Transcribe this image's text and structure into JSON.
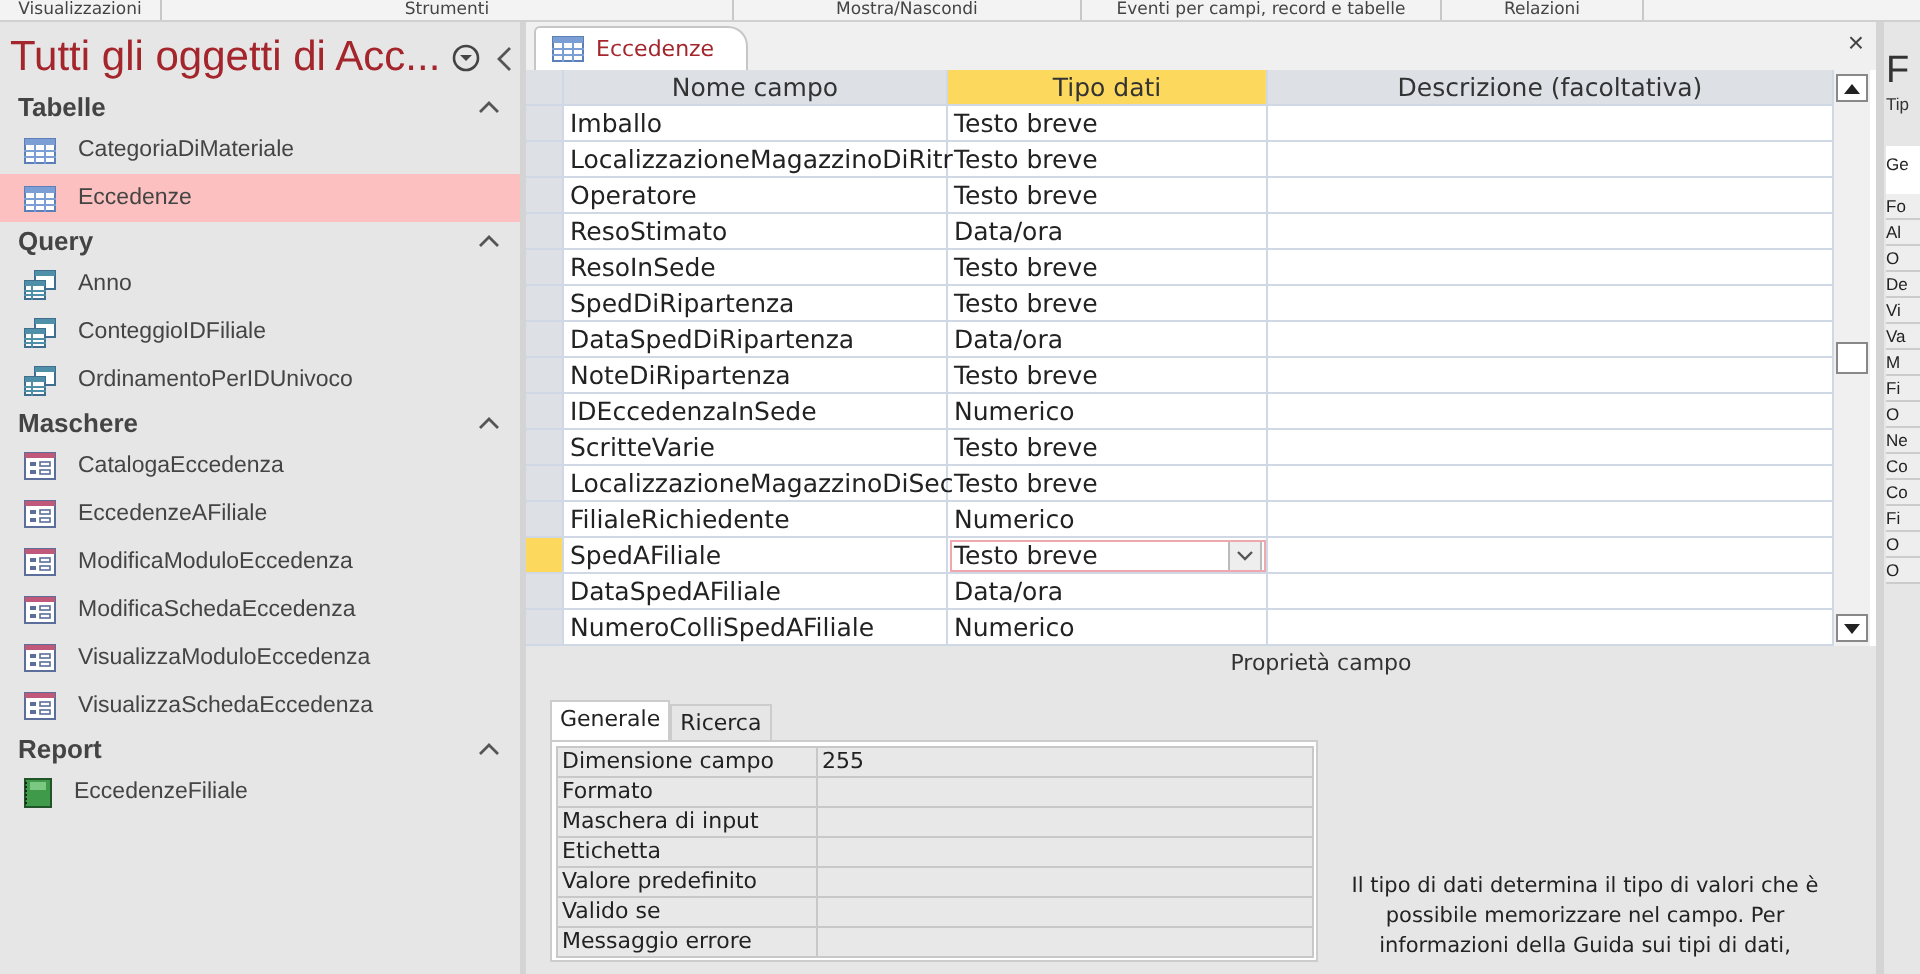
{
  "ribbon_groups": [
    "Visualizzazioni",
    "Strumenti",
    "Mostra/Nascondi",
    "Eventi per campi, record e tabelle",
    "Relazioni"
  ],
  "navigation": {
    "title": "Tutti gli oggetti di Acc...",
    "sections": [
      {
        "title": "Tabelle",
        "expanded": true,
        "items": [
          {
            "label": "CategoriaDiMateriale",
            "kind": "table",
            "selected": false
          },
          {
            "label": "Eccedenze",
            "kind": "table",
            "selected": true
          }
        ]
      },
      {
        "title": "Query",
        "expanded": true,
        "items": [
          {
            "label": "Anno",
            "kind": "query",
            "selected": false
          },
          {
            "label": "ConteggioIDFiliale",
            "kind": "query",
            "selected": false
          },
          {
            "label": "OrdinamentoPerIDUnivoco",
            "kind": "query",
            "selected": false
          }
        ]
      },
      {
        "title": "Maschere",
        "expanded": true,
        "items": [
          {
            "label": "CatalogaEccedenza",
            "kind": "form",
            "selected": false
          },
          {
            "label": "EccedenzeAFiliale",
            "kind": "form",
            "selected": false
          },
          {
            "label": "ModificaModuloEccedenza",
            "kind": "form",
            "selected": false
          },
          {
            "label": "ModificaSchedaEccedenza",
            "kind": "form",
            "selected": false
          },
          {
            "label": "VisualizzaModuloEccedenza",
            "kind": "form",
            "selected": false
          },
          {
            "label": "VisualizzaSchedaEccedenza",
            "kind": "form",
            "selected": false
          }
        ]
      },
      {
        "title": "Report",
        "expanded": true,
        "items": [
          {
            "label": "EccedenzeFiliale",
            "kind": "report",
            "selected": false
          }
        ]
      }
    ]
  },
  "document_tabs": [
    {
      "label": "Eccedenze",
      "selected": true
    }
  ],
  "close_label": "×",
  "table": {
    "columns": [
      {
        "label": "Nome campo",
        "selected": false
      },
      {
        "label": "Tipo dati",
        "selected": true
      },
      {
        "label": "Descrizione (facoltativa)",
        "selected": false
      }
    ],
    "rows": [
      {
        "name": "Imballo",
        "type": "Testo breve",
        "selected": false
      },
      {
        "name": "LocalizzazioneMagazzinoDiRitr",
        "type": "Testo breve",
        "selected": false
      },
      {
        "name": "Operatore",
        "type": "Testo breve",
        "selected": false
      },
      {
        "name": "ResoStimato",
        "type": "Data/ora",
        "selected": false
      },
      {
        "name": "ResoInSede",
        "type": "Testo breve",
        "selected": false
      },
      {
        "name": "SpedDiRipartenza",
        "type": "Testo breve",
        "selected": false
      },
      {
        "name": "DataSpedDiRipartenza",
        "type": "Data/ora",
        "selected": false
      },
      {
        "name": "NoteDiRipartenza",
        "type": "Testo breve",
        "selected": false
      },
      {
        "name": "IDEccedenzaInSede",
        "type": "Numerico",
        "selected": false
      },
      {
        "name": "ScritteVarie",
        "type": "Testo breve",
        "selected": false
      },
      {
        "name": "LocalizzazioneMagazzinoDiSec",
        "type": "Testo breve",
        "selected": false
      },
      {
        "name": "FilialeRichiedente",
        "type": "Numerico",
        "selected": false
      },
      {
        "name": "SpedAFiliale",
        "type": "Testo breve",
        "selected": true
      },
      {
        "name": "DataSpedAFiliale",
        "type": "Data/ora",
        "selected": false
      },
      {
        "name": "NumeroColliSpedAFiliale",
        "type": "Numerico",
        "selected": false
      }
    ]
  },
  "field_properties": {
    "title": "Proprietà campo",
    "tabs": [
      {
        "label": "Generale",
        "selected": true
      },
      {
        "label": "Ricerca",
        "selected": false
      }
    ],
    "rows": [
      {
        "label": "Dimensione campo",
        "value": "255"
      },
      {
        "label": "Formato"
      },
      {
        "label": "Maschera di input"
      },
      {
        "label": "Etichetta"
      },
      {
        "label": "Valore predefinito"
      },
      {
        "label": "Valido se"
      },
      {
        "label": "Messaggio errore"
      }
    ],
    "help": "Il tipo di dati determina il tipo di valori che è possibile memorizzare nel campo. Per informazioni della Guida sui tipi di dati,"
  },
  "property_sheet": {
    "title": "F",
    "subtitle": "Tip",
    "tab": "Ge",
    "rows": [
      "Fo",
      "Al",
      "O",
      "De",
      "Vi",
      "Va",
      "M",
      "Fi",
      "O",
      "Ne",
      "Co",
      "Co",
      "Fi",
      "O",
      "O"
    ]
  }
}
